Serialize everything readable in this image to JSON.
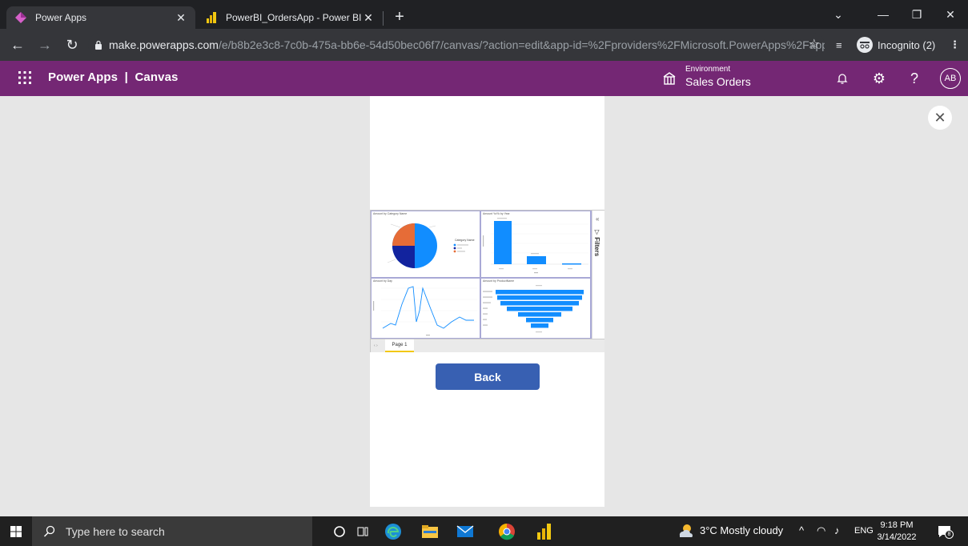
{
  "browser": {
    "tabs": [
      {
        "title": "Power Apps",
        "active": true
      },
      {
        "title": "PowerBI_OrdersApp - Power BI",
        "active": false
      }
    ],
    "new_tab_label": "+",
    "url_host": "make.powerapps.com",
    "url_path": "/e/b8b2e3c8-7c0b-475a-bb6e-54d50bec06f7/canvas/?action=edit&app-id=%2Fproviders%2FMicrosoft.PowerApps%2Fapp...",
    "incognito_label": "Incognito (2)"
  },
  "header": {
    "brand": "Power Apps  |  Canvas",
    "environment_label": "Environment",
    "environment_name": "Sales Orders",
    "avatar_initials": "AB",
    "help_label": "?"
  },
  "report": {
    "visual_titles": {
      "pie": "Amount by Category Name",
      "bar": "Amount YoYk by Year",
      "line": "Amount by Day",
      "funnel": "Amount by ProductName"
    },
    "pie_legend_title": "Category Name",
    "filters_label": "Filters",
    "page_tab": "Page 1"
  },
  "app": {
    "back_button": "Back"
  },
  "taskbar": {
    "search_placeholder": "Type here to search",
    "weather": "3°C  Mostly cloudy",
    "language": "ENG",
    "time": "9:18 PM",
    "date": "3/14/2022",
    "notification_count": "8"
  },
  "colors": {
    "browser_dark": "#202124",
    "powerapps_purple": "#742774",
    "button_blue": "#3860b2",
    "pbi_blue": "#118dff",
    "pbi_navy": "#12239e",
    "pbi_orange": "#e66c37"
  }
}
